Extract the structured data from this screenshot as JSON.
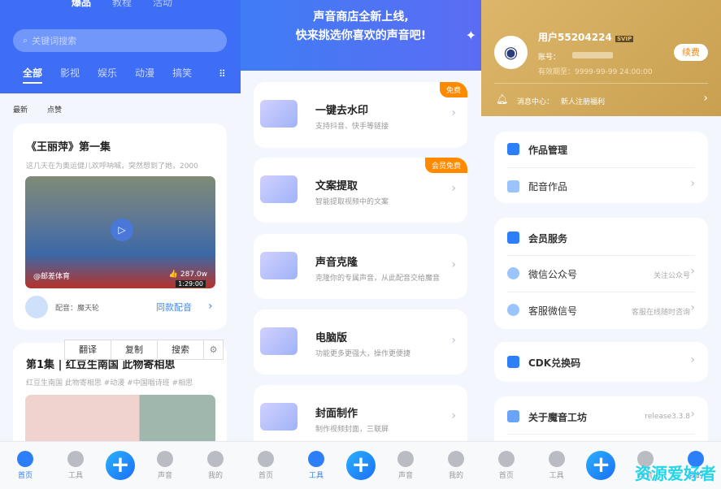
{
  "home": {
    "top_tabs": [
      "爆品",
      "教程",
      "活动"
    ],
    "search_placeholder": "关键词搜索",
    "categories": [
      "全部",
      "影视",
      "娱乐",
      "动漫",
      "搞笑"
    ],
    "sort": [
      "最新",
      "点赞"
    ],
    "cards": [
      {
        "title": "《王丽萍》第一集",
        "desc": "这几天在为奥运健儿欢呼呐喊，突然想到了她，2000",
        "source": "@邮差体育",
        "likes": "287.0w",
        "duration": "1:29:00",
        "dubber": "配音：魔天轮",
        "action": "同款配音"
      },
      {
        "title": "第1集 | 红豆生南国  此物寄相思",
        "desc": "红豆生南国  此物寄相思 #动漫 #中国唱诗班 #相思"
      }
    ],
    "context_menu": [
      "翻译",
      "复制",
      "搜索"
    ]
  },
  "tools": {
    "banner": [
      "声音商店全新上线,",
      "快来挑选你喜欢的声音吧!"
    ],
    "items": [
      {
        "title": "一键去水印",
        "desc": "支持抖音、快手等链接",
        "badge": "免费"
      },
      {
        "title": "文案提取",
        "desc": "智能提取视频中的文案",
        "badge": "会员免费"
      },
      {
        "title": "声音克隆",
        "desc": "克隆你的专属声音，从此配音交给魔音"
      },
      {
        "title": "电脑版",
        "desc": "功能更多更强大，操作更便捷"
      },
      {
        "title": "封面制作",
        "desc": "制作视频封面，三联屏"
      }
    ]
  },
  "profile": {
    "username": "用户55204224",
    "vip": "SVIP",
    "account_label": "账号：",
    "expiry": "有效期至：9999-99-99 24:00:00",
    "renew": "续费",
    "message_label": "消息中心：",
    "message": "新人注册福利",
    "works_header": "作品管理",
    "works_item": "配音作品",
    "member_header": "会员服务",
    "wechat": "微信公众号",
    "wechat_sub": "关注公众号",
    "service": "客服微信号",
    "service_sub": "客服在线随时咨询",
    "cdk": "CDK兑换码",
    "about": "关于魔音工坊",
    "version": "release3.3.8",
    "watermark": "资源爱好者"
  },
  "nav": {
    "items": [
      "首页",
      "工具",
      "声音",
      "我的"
    ]
  },
  "colors": {
    "primary": "#3d6ef5",
    "accent": "#2d7ff9",
    "badge": "#ff8a00",
    "gold": "#d6ad5e"
  }
}
